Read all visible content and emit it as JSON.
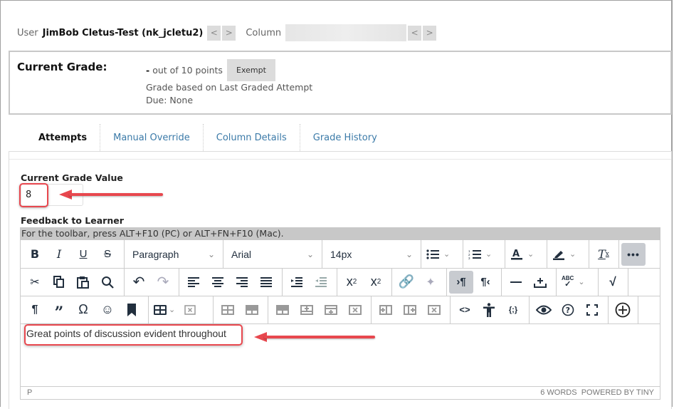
{
  "header": {
    "user_label": "User",
    "user_name": "JimBob Cletus-Test (nk_jcletu2)",
    "prev_user": "<",
    "next_user": ">",
    "column_label": "Column",
    "column_value": "",
    "prev_column": "<",
    "next_column": ">"
  },
  "current_grade": {
    "title": "Current Grade:",
    "value": "-",
    "out_of": "out of 10 points",
    "exempt_label": "Exempt",
    "grade_basis": "Grade based on Last Graded Attempt",
    "due": "Due: None"
  },
  "tabs": [
    {
      "label": "Attempts",
      "active": true
    },
    {
      "label": "Manual Override",
      "active": false
    },
    {
      "label": "Column Details",
      "active": false
    },
    {
      "label": "Grade History",
      "active": false
    }
  ],
  "form": {
    "grade_value_label": "Current Grade Value",
    "grade_value": "8",
    "feedback_label": "Feedback to Learner",
    "toolbar_hint": "For the toolbar, press ALT+F10 (PC) or ALT+FN+F10 (Mac)."
  },
  "editor": {
    "block_format": "Paragraph",
    "font_family": "Arial",
    "font_size": "14px",
    "content": "Great points of discussion evident throughout",
    "status_path": "P",
    "word_count": "6 WORDS",
    "powered_by": "POWERED BY TINY",
    "toolbar_row1": [
      "bold-icon",
      "italic-icon",
      "underline-icon",
      "strikethrough-icon",
      "block-format-select",
      "font-family-select",
      "font-size-select",
      "bullet-list-icon",
      "numbered-list-icon",
      "text-color-icon",
      "highlight-color-icon",
      "clear-formatting-icon",
      "more-icon"
    ],
    "toolbar_row2": [
      "cut-icon",
      "copy-icon",
      "paste-icon",
      "find-icon",
      "undo-icon",
      "redo-icon",
      "align-left-icon",
      "align-center-icon",
      "align-right-icon",
      "justify-icon",
      "indent-icon",
      "outdent-icon",
      "superscript-icon",
      "subscript-icon",
      "link-icon",
      "unlink-icon",
      "ltr-icon",
      "rtl-icon",
      "horizontal-rule-icon",
      "insert-icon",
      "spellcheck-icon",
      "math-icon"
    ],
    "toolbar_row3": [
      "paragraph-mark-icon",
      "blockquote-icon",
      "special-char-icon",
      "emoji-icon",
      "bookmark-icon",
      "table-icon",
      "delete-table-icon",
      "table-row-icon",
      "table-cell-icon",
      "split-cell-icon",
      "insert-row-before-icon",
      "insert-row-after-icon",
      "delete-row-icon",
      "insert-col-before-icon",
      "insert-col-after-icon",
      "delete-col-icon",
      "code-icon",
      "accessibility-icon",
      "source-code-icon",
      "preview-icon",
      "help-icon",
      "fullscreen-icon",
      "add-content-icon"
    ]
  },
  "annotation_color": "#e8474e"
}
